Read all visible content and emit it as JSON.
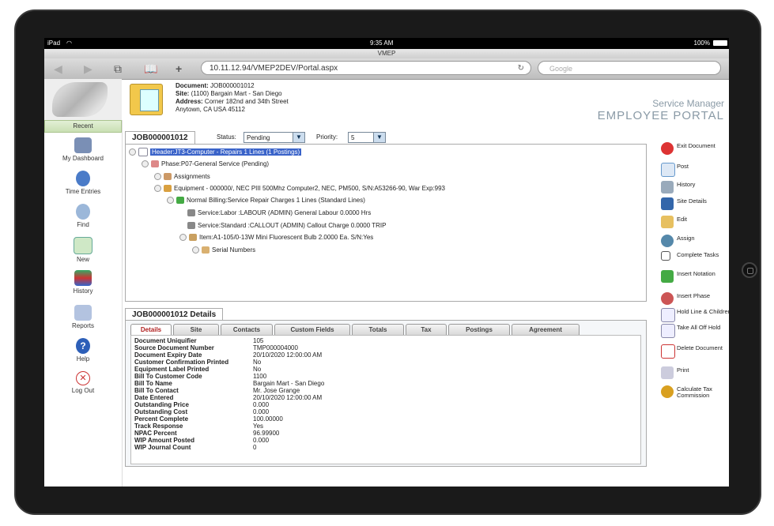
{
  "statusbar": {
    "carrier": "iPad",
    "time": "9:35 AM",
    "battery": "100%"
  },
  "browser": {
    "title": "VMEP",
    "url": "10.11.12.94/VMEP2DEV/Portal.aspx",
    "search_placeholder": "Google"
  },
  "header": {
    "document_label": "Document:",
    "document_value": "JOB000001012",
    "site_label": "Site:",
    "site_value": "(1100) Bargain Mart - San Diego",
    "address_label": "Address:",
    "address_line1": "Corner 182nd and 34th Street",
    "address_line2": "Anytown, CA USA 45112",
    "brand_line1": "Service Manager",
    "brand_line2": "EMPLOYEE PORTAL"
  },
  "leftnav": {
    "recent": "Recent",
    "items": [
      {
        "label": "My Dashboard",
        "icon": "dashboard-icon"
      },
      {
        "label": "Time Entries",
        "icon": "clock-icon"
      },
      {
        "label": "Find",
        "icon": "magnifier-icon"
      },
      {
        "label": "New",
        "icon": "new-document-icon"
      },
      {
        "label": "History",
        "icon": "books-icon"
      },
      {
        "label": "Reports",
        "icon": "reports-icon"
      },
      {
        "label": "Help",
        "icon": "help-icon"
      },
      {
        "label": "Log Out",
        "icon": "logout-icon"
      }
    ]
  },
  "job": {
    "id": "JOB000001012",
    "status_label": "Status:",
    "status_value": "Pending",
    "priority_label": "Priority:",
    "priority_value": "5"
  },
  "tree": [
    {
      "text": "Header:JT3-Computer - Repairs 1 Lines (1 Postings)",
      "selected": true
    },
    {
      "text": "Phase:P07-General Service (Pending)"
    },
    {
      "text": "Assignments"
    },
    {
      "text": "Equipment - 000000/, NEC PIII 500Mhz Computer2, NEC, PM500, S/N:A53266-90, War Exp:993"
    },
    {
      "text": "Normal Billing:Service Repair Charges 1 Lines (Standard Lines)"
    },
    {
      "text": "Service:Labor :LABOUR (ADMIN) General Labour 0.0000 Hrs"
    },
    {
      "text": "Service:Standard :CALLOUT (ADMIN) Callout Charge 0.0000 TRIP"
    },
    {
      "text": "Item:A1-105/0-13W Mini Fluorescent Bulb 2.0000 Ea. S/N:Yes"
    },
    {
      "text": "Serial Numbers"
    }
  ],
  "details": {
    "title": "JOB000001012 Details",
    "tabs": [
      "Details",
      "Site",
      "Contacts",
      "Custom Fields",
      "Totals",
      "Tax",
      "Postings",
      "Agreement"
    ],
    "rows": [
      {
        "k": "Document Uniquifier",
        "v": "105"
      },
      {
        "k": "Source Document Number",
        "v": "TMP000004000"
      },
      {
        "k": "Document Expiry Date",
        "v": "20/10/2020 12:00:00 AM"
      },
      {
        "k": "Customer Confirmation Printed",
        "v": "No"
      },
      {
        "k": "Equipment Label Printed",
        "v": "No"
      },
      {
        "k": "Bill To Customer Code",
        "v": "1100"
      },
      {
        "k": "Bill To Name",
        "v": "Bargain Mart - San Diego"
      },
      {
        "k": "Bill To Contact",
        "v": "Mr. Jose Grange"
      },
      {
        "k": "Date Entered",
        "v": "20/10/2020 12:00:00 AM"
      },
      {
        "k": "Outstanding Price",
        "v": "0.000"
      },
      {
        "k": "Outstanding Cost",
        "v": "0.000"
      },
      {
        "k": "Percent Complete",
        "v": "100.00000"
      },
      {
        "k": "Track Response",
        "v": "Yes"
      },
      {
        "k": "NPAC Percent",
        "v": "96.99900"
      },
      {
        "k": "WIP Amount Posted",
        "v": "0.000"
      },
      {
        "k": "WIP Journal Count",
        "v": "0"
      }
    ]
  },
  "actions": [
    {
      "label": "Exit Document",
      "icon": "exit-icon"
    },
    {
      "label": "Post",
      "icon": "post-icon"
    },
    {
      "label": "History",
      "icon": "history-icon"
    },
    {
      "label": "Site Details",
      "icon": "site-details-icon"
    },
    {
      "label": "Edit",
      "icon": "pencil-icon"
    },
    {
      "label": "Assign",
      "icon": "person-icon"
    },
    {
      "label": "Complete Tasks",
      "icon": "checkbox-icon"
    },
    {
      "label": "Insert Notation",
      "icon": "notation-icon"
    },
    {
      "label": "Insert Phase",
      "icon": "phase-icon"
    },
    {
      "label": "Hold Line & Children",
      "icon": "hold-line-icon"
    },
    {
      "label": "Take All Off Hold",
      "icon": "take-off-hold-icon"
    },
    {
      "label": "Delete Document",
      "icon": "delete-document-icon"
    },
    {
      "label": "Print",
      "icon": "printer-icon"
    },
    {
      "label": "Calculate Tax Commission",
      "icon": "coins-icon"
    }
  ]
}
